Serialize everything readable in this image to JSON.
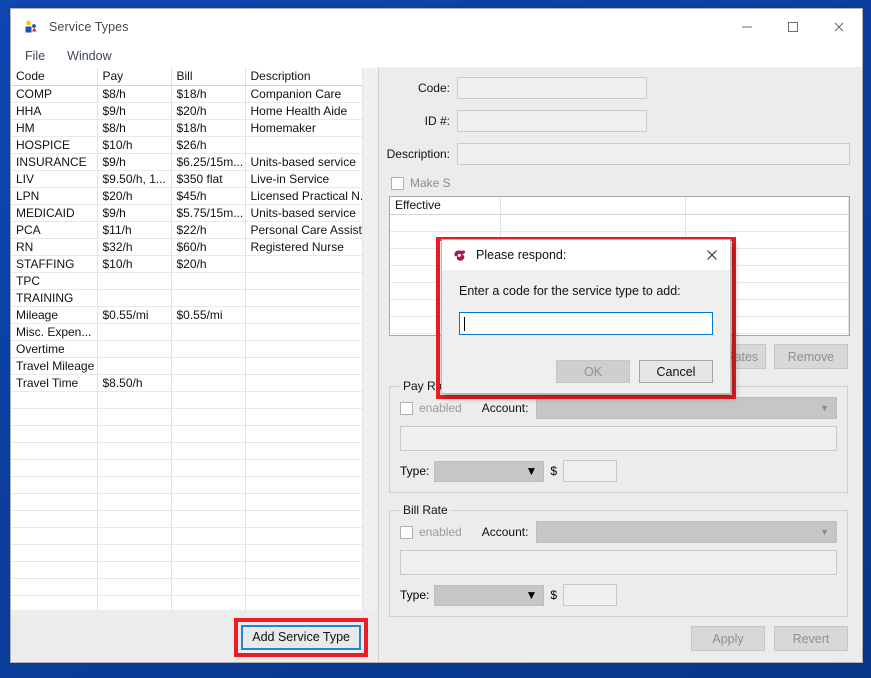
{
  "window": {
    "title": "Service Types",
    "app_icon": "people-group-icon",
    "controls": {
      "minimize": "minimize-icon",
      "maximize": "maximize-icon",
      "close": "close-icon"
    }
  },
  "menubar": {
    "items": [
      "File",
      "Window"
    ]
  },
  "service_grid": {
    "columns": [
      "Code",
      "Pay",
      "Bill",
      "Description"
    ],
    "rows": [
      {
        "code": "COMP",
        "pay": "$8/h",
        "bill": "$18/h",
        "description": "Companion Care"
      },
      {
        "code": "HHA",
        "pay": "$9/h",
        "bill": "$20/h",
        "description": "Home Health Aide"
      },
      {
        "code": "HM",
        "pay": "$8/h",
        "bill": "$18/h",
        "description": "Homemaker"
      },
      {
        "code": "HOSPICE",
        "pay": "$10/h",
        "bill": "$26/h",
        "description": ""
      },
      {
        "code": "INSURANCE",
        "pay": "$9/h",
        "bill": "$6.25/15m...",
        "description": "Units-based service"
      },
      {
        "code": "LIV",
        "pay": "$9.50/h, 1...",
        "bill": "$350 flat",
        "description": "Live-in Service"
      },
      {
        "code": "LPN",
        "pay": "$20/h",
        "bill": "$45/h",
        "description": "Licensed Practical N..."
      },
      {
        "code": "MEDICAID",
        "pay": "$9/h",
        "bill": "$5.75/15m...",
        "description": "Units-based service"
      },
      {
        "code": "PCA",
        "pay": "$11/h",
        "bill": "$22/h",
        "description": "Personal Care Assistant"
      },
      {
        "code": "RN",
        "pay": "$32/h",
        "bill": "$60/h",
        "description": "Registered Nurse"
      },
      {
        "code": "STAFFING",
        "pay": "$10/h",
        "bill": "$20/h",
        "description": ""
      },
      {
        "code": "TPC",
        "pay": "",
        "bill": "",
        "description": ""
      },
      {
        "code": "TRAINING",
        "pay": "",
        "bill": "",
        "description": ""
      },
      {
        "code": "Mileage",
        "pay": "$0.55/mi",
        "bill": "$0.55/mi",
        "description": ""
      },
      {
        "code": "Misc. Expen...",
        "pay": "",
        "bill": "",
        "description": ""
      },
      {
        "code": "Overtime",
        "pay": "",
        "bill": "",
        "description": ""
      },
      {
        "code": "Travel Mileage",
        "pay": "",
        "bill": "",
        "description": ""
      },
      {
        "code": "Travel Time",
        "pay": "$8.50/h",
        "bill": "",
        "description": ""
      },
      {
        "code": "",
        "pay": "",
        "bill": "",
        "description": ""
      },
      {
        "code": "",
        "pay": "",
        "bill": "",
        "description": ""
      },
      {
        "code": "",
        "pay": "",
        "bill": "",
        "description": ""
      },
      {
        "code": "",
        "pay": "",
        "bill": "",
        "description": ""
      },
      {
        "code": "",
        "pay": "",
        "bill": "",
        "description": ""
      },
      {
        "code": "",
        "pay": "",
        "bill": "",
        "description": ""
      },
      {
        "code": "",
        "pay": "",
        "bill": "",
        "description": ""
      },
      {
        "code": "",
        "pay": "",
        "bill": "",
        "description": ""
      },
      {
        "code": "",
        "pay": "",
        "bill": "",
        "description": ""
      },
      {
        "code": "",
        "pay": "",
        "bill": "",
        "description": ""
      },
      {
        "code": "",
        "pay": "",
        "bill": "",
        "description": ""
      },
      {
        "code": "",
        "pay": "",
        "bill": "",
        "description": ""
      },
      {
        "code": "",
        "pay": "",
        "bill": "",
        "description": ""
      }
    ],
    "add_button_label": "Add Service Type",
    "add_button_highlight_color": "#ee1c25",
    "add_button_focus_color": "#1e86d6"
  },
  "detail": {
    "code_label": "Code:",
    "code_value": "",
    "id_label": "ID #:",
    "id_value": "",
    "description_label": "Description:",
    "description_value": "",
    "make_checkbox_label": "Make S",
    "effective_table": {
      "columns": [
        "Effective",
        "",
        ""
      ]
    },
    "add_rates_label": "Add Rates",
    "remove_label": "Remove",
    "pay_rate": {
      "group_label": "Pay Rate",
      "enabled_label": "enabled",
      "enabled_checked": false,
      "account_label": "Account:",
      "account_value": "",
      "account_detail_value": "",
      "type_label": "Type:",
      "type_value": "",
      "currency_symbol": "$",
      "amount_value": ""
    },
    "bill_rate": {
      "group_label": "Bill Rate",
      "enabled_label": "enabled",
      "enabled_checked": false,
      "account_label": "Account:",
      "account_value": "",
      "account_detail_value": "",
      "type_label": "Type:",
      "type_value": "",
      "currency_symbol": "$",
      "amount_value": ""
    },
    "apply_label": "Apply",
    "revert_label": "Revert"
  },
  "dialog": {
    "title": "Please respond:",
    "icon": "rose-app-icon",
    "close_icon": "close-icon",
    "prompt": "Enter a code for the service type to add:",
    "input_value": "",
    "ok_label": "OK",
    "ok_disabled": true,
    "cancel_label": "Cancel",
    "highlight_color": "#ee1c25",
    "input_focus_color": "#0078d7"
  }
}
